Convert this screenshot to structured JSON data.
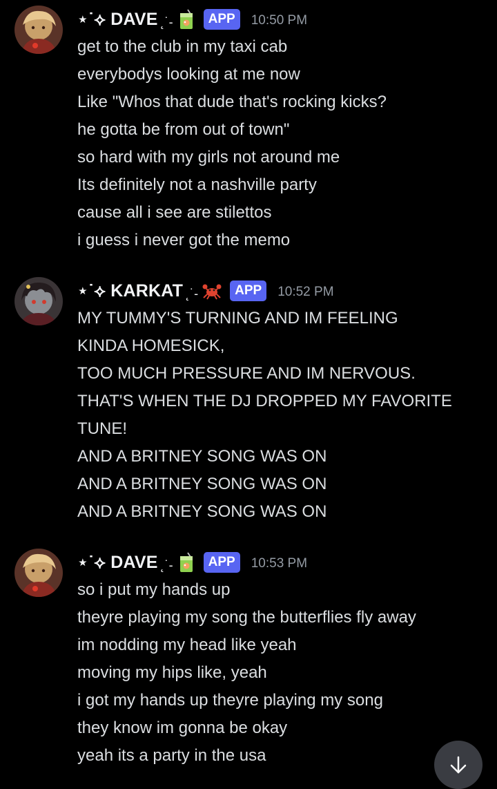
{
  "messages": [
    {
      "author": "⋆˙⟡ DAVE",
      "author_deco": "˛˙-",
      "emoji": "juice-box-icon",
      "badge": "APP",
      "time": "10:50 PM",
      "lines": [
        "get to the club in my taxi cab",
        "everybodys looking at me now",
        "Like \"Whos that dude that's rocking kicks?",
        "he gotta be from out of town\"",
        "so hard with my girls not around me",
        "Its definitely not a nashville party",
        "cause all i see are stilettos",
        "i guess i never got the memo"
      ]
    },
    {
      "author": "⋆˙⟡ KARKAT",
      "author_deco": "˛˙-",
      "emoji": "crab-icon",
      "badge": "APP",
      "time": "10:52 PM",
      "lines": [
        "MY TUMMY'S TURNING AND IM FEELING",
        "KINDA HOMESICK,",
        "TOO MUCH PRESSURE AND IM NERVOUS.",
        "THAT'S WHEN THE DJ DROPPED MY FAVORITE",
        "TUNE!",
        "AND A BRITNEY SONG WAS ON",
        "AND A BRITNEY SONG WAS ON",
        "AND A BRITNEY SONG WAS ON"
      ]
    },
    {
      "author": "⋆˙⟡ DAVE",
      "author_deco": "˛˙-",
      "emoji": "juice-box-icon",
      "badge": "APP",
      "time": "10:53 PM",
      "lines": [
        "so i put my hands up",
        "theyre playing my song the butterflies fly away",
        "im nodding my head like yeah",
        "moving my hips like, yeah",
        "i got my hands up theyre playing my song",
        "they know im gonna be okay",
        "yeah its a party in the usa"
      ]
    }
  ],
  "colors": {
    "background": "#000000",
    "text": "#dbdee1",
    "username": "#f2f3f5",
    "timestamp": "#949ba4",
    "badge": "#5865f2"
  },
  "scroll_button": {
    "icon": "arrow-down-icon"
  }
}
